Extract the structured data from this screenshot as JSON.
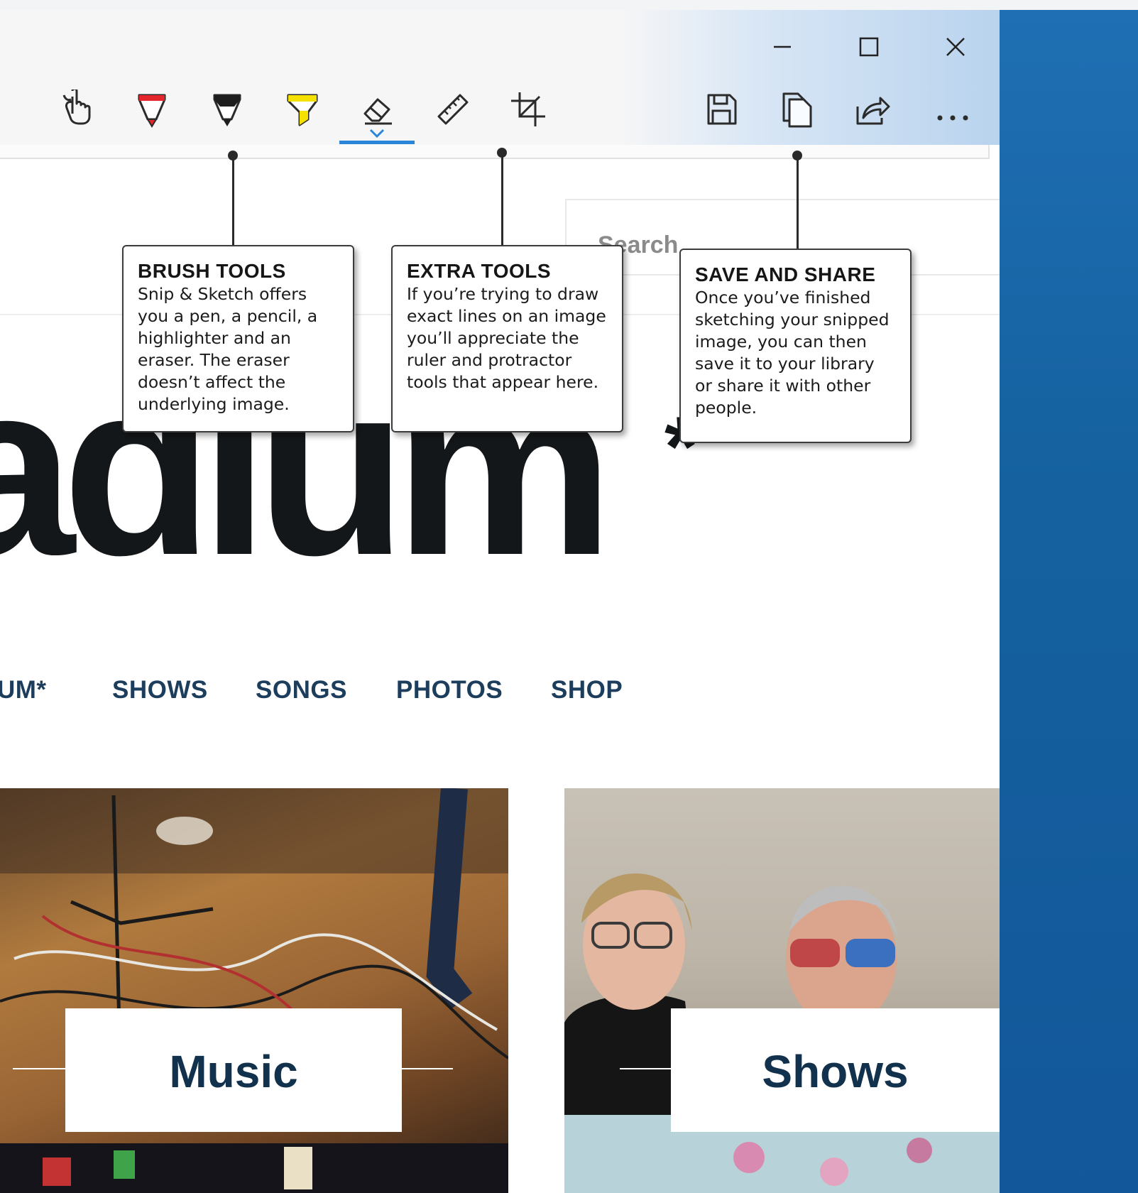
{
  "window": {
    "controls": {
      "minimize_icon": "minimize-icon",
      "maximize_icon": "maximize-icon",
      "close_icon": "close-icon"
    },
    "toolbar": {
      "tools": [
        {
          "name": "touch-writing-icon"
        },
        {
          "name": "ballpoint-pen-icon",
          "color": "#e3262b"
        },
        {
          "name": "pencil-icon",
          "color": "#1e1e1e"
        },
        {
          "name": "highlighter-icon",
          "color": "#f4e100"
        },
        {
          "name": "eraser-icon",
          "active": true
        },
        {
          "name": "ruler-icon"
        },
        {
          "name": "crop-icon"
        },
        {
          "name": "save-icon"
        },
        {
          "name": "copy-icon"
        },
        {
          "name": "share-icon"
        },
        {
          "name": "more-icon"
        }
      ],
      "active_color": "#2a86d8"
    }
  },
  "website": {
    "search_placeholder": "Search ...",
    "logo_text": "adium",
    "logo_star": "*",
    "nav": [
      "UM*",
      "SHOWS",
      "SONGS",
      "PHOTOS",
      "SHOP"
    ],
    "cards": [
      {
        "label": "Music"
      },
      {
        "label": "Shows"
      }
    ]
  },
  "callouts": [
    {
      "title": "BRUSH TOOLS",
      "body": "Snip & Sketch offers you a pen, a pencil, a highlighter and an eraser. The eraser doesn’t affect the underlying image."
    },
    {
      "title": "EXTRA TOOLS",
      "body": "If you’re trying to draw exact lines on an image you’ll appreciate the ruler and protractor tools that appear here."
    },
    {
      "title": "SAVE AND SHARE",
      "body": "Once you’ve finished sketching your snipped image, you can then save it to your library or share it with other people."
    }
  ],
  "colors": {
    "desktop_blue": "#1a64a6",
    "nav_text": "#1c3e5c",
    "logo_text": "#141719"
  }
}
